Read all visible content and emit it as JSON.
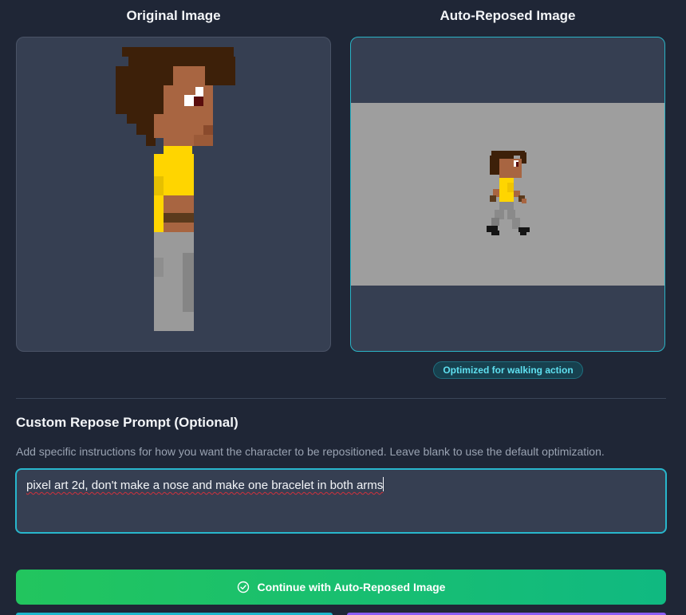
{
  "columns": {
    "original_title": "Original Image",
    "reposed_title": "Auto-Reposed Image"
  },
  "badge": {
    "label": "Optimized for walking action"
  },
  "custom_prompt": {
    "title": "Custom Repose Prompt (Optional)",
    "description": "Add specific instructions for how you want the character to be repositioned. Leave blank to use the default optimization.",
    "value": "pixel art 2d, don't make a nose and make one bracelet in both arms"
  },
  "actions": {
    "continue_label": "Continue with Auto-Reposed Image",
    "continue_icon": "check-circle-icon"
  },
  "colors": {
    "background": "#1f2636",
    "panel": "#363f52",
    "accent_cyan": "#28b6cc",
    "continue_green": "#22c55e",
    "badge_text": "#5fe0f0",
    "hair": "#3d2009",
    "skin": "#a86541",
    "shirt": "#ffd500",
    "pants": "#9a9a9a"
  }
}
